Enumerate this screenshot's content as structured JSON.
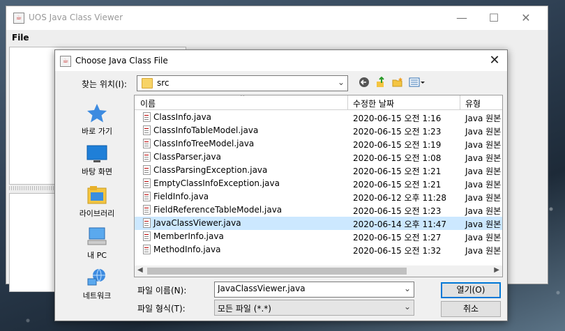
{
  "main_window": {
    "title": "UOS Java Class Viewer",
    "menu": [
      "File"
    ],
    "window_controls": [
      "minimize",
      "maximize",
      "close"
    ]
  },
  "dialog": {
    "title": "Choose Java Class File",
    "look_in_label": "찾는 위치(I):",
    "look_in_value": "src",
    "toolbar_icons": [
      "up-one-level-icon",
      "home-icon",
      "new-folder-icon",
      "view-menu-icon"
    ],
    "places": [
      {
        "label": "바로 가기",
        "icon": "star-icon"
      },
      {
        "label": "바탕 화면",
        "icon": "desktop-icon"
      },
      {
        "label": "라이브러리",
        "icon": "library-icon"
      },
      {
        "label": "내 PC",
        "icon": "computer-icon"
      },
      {
        "label": "네트워크",
        "icon": "network-icon"
      }
    ],
    "columns": {
      "name": "이름",
      "date": "수정한 날짜",
      "type": "유형"
    },
    "files": [
      {
        "name": "ClassInfo.java",
        "date": "2020-06-15 오전 1:16",
        "type": "Java 원본"
      },
      {
        "name": "ClassInfoTableModel.java",
        "date": "2020-06-15 오전 1:23",
        "type": "Java 원본"
      },
      {
        "name": "ClassInfoTreeModel.java",
        "date": "2020-06-15 오전 1:19",
        "type": "Java 원본"
      },
      {
        "name": "ClassParser.java",
        "date": "2020-06-15 오전 1:08",
        "type": "Java 원본"
      },
      {
        "name": "ClassParsingException.java",
        "date": "2020-06-15 오전 1:21",
        "type": "Java 원본"
      },
      {
        "name": "EmptyClassInfoException.java",
        "date": "2020-06-15 오전 1:21",
        "type": "Java 원본"
      },
      {
        "name": "FieldInfo.java",
        "date": "2020-06-12 오후 11:28",
        "type": "Java 원본"
      },
      {
        "name": "FieldReferenceTableModel.java",
        "date": "2020-06-15 오전 1:23",
        "type": "Java 원본"
      },
      {
        "name": "JavaClassViewer.java",
        "date": "2020-06-14 오후 11:47",
        "type": "Java 원본",
        "selected": true
      },
      {
        "name": "MemberInfo.java",
        "date": "2020-06-15 오전 1:27",
        "type": "Java 원본"
      },
      {
        "name": "MethodInfo.java",
        "date": "2020-06-15 오전 1:32",
        "type": "Java 원본"
      }
    ],
    "file_name_label": "파일 이름(N):",
    "file_name_value": "JavaClassViewer.java",
    "file_type_label": "파일 형식(T):",
    "file_type_value": "모든 파일 (*.*)",
    "open_button": "열기(O)",
    "cancel_button": "취소",
    "selection_color": "#cce8ff"
  }
}
